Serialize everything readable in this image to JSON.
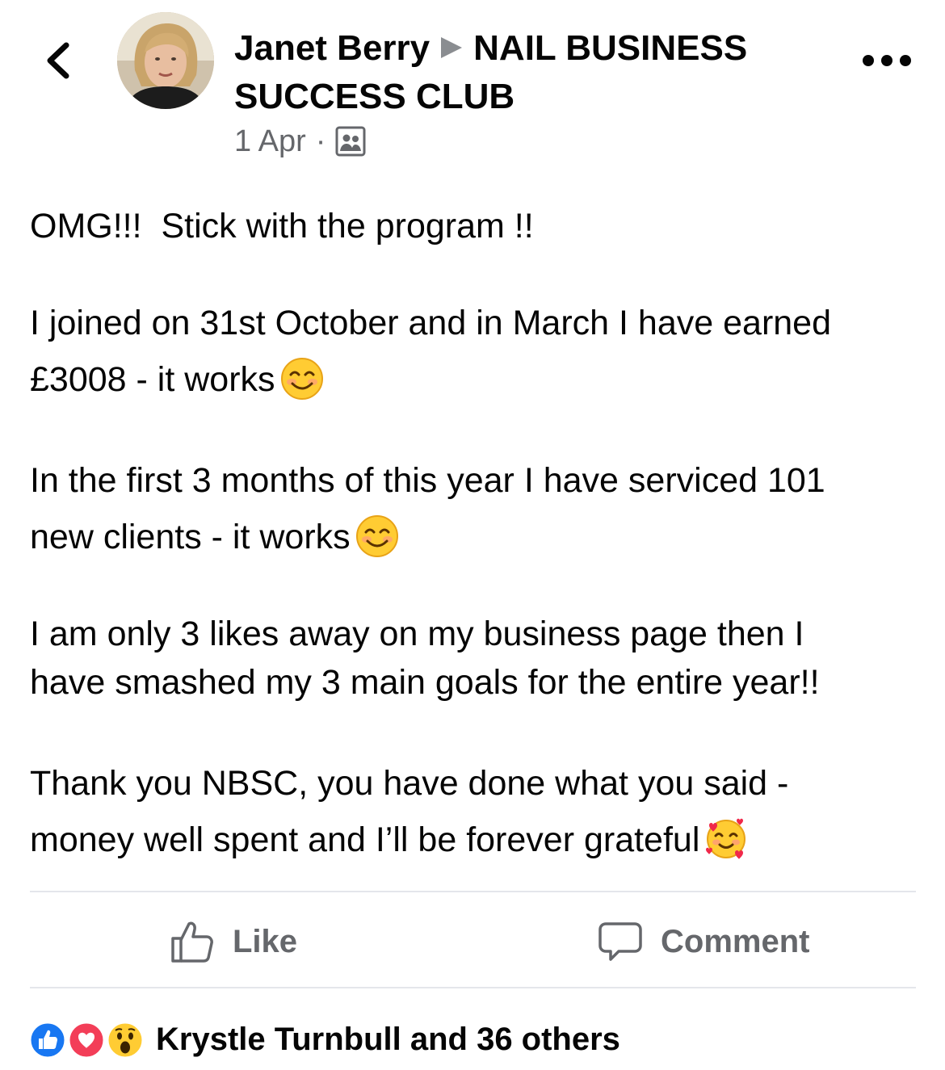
{
  "post": {
    "author": "Janet Berry",
    "group": "NAIL BUSINESS SUCCESS CLUB",
    "date": "1 Apr",
    "separator": "·",
    "audience_icon": "group-audience-icon"
  },
  "content": {
    "p1": "OMG!!!  Stick with the program !!",
    "p2": "I joined on 31st October and in March I have earned\n£3008 - it works",
    "p3": "In the first 3 months of this year I have serviced 101\nnew clients - it works",
    "p4": "I am only 3 likes away on my business page then I\nhave smashed my 3 main goals for the entire year!!",
    "p5": "Thank you NBSC, you have done what you said -\nmoney well spent and I’ll be forever grateful"
  },
  "actions": {
    "like_label": "Like",
    "comment_label": "Comment"
  },
  "reactions": {
    "summary": "Krystle Turnbull and 36 others",
    "types": [
      "like",
      "love",
      "wow"
    ]
  },
  "colors": {
    "text": "#050505",
    "secondary": "#65676b",
    "like_blue": "#1877f2",
    "love_red": "#f33e58",
    "divider": "#e4e6eb"
  }
}
